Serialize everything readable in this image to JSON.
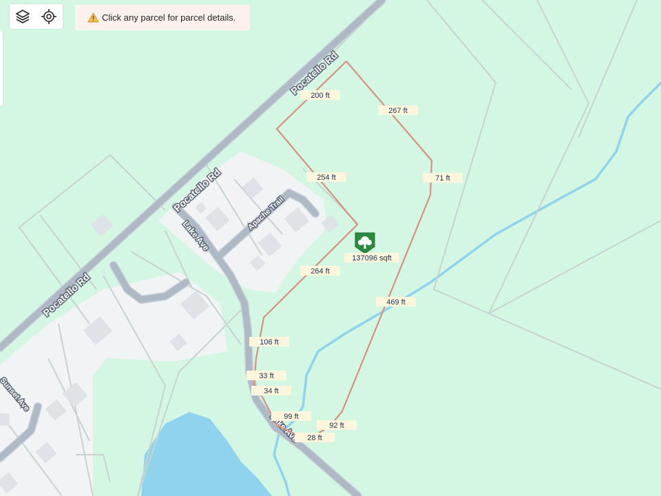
{
  "toolbar": {
    "layers_icon": "layers-icon",
    "locate_icon": "crosshair-locate-icon"
  },
  "notice": {
    "icon": "warning-triangle-icon",
    "text": "Click any parcel for parcel details."
  },
  "roads": {
    "pocatello_1": "Pocatello Rd",
    "pocatello_2": "Pocatello Rd",
    "pocatello_3": "Pocatello Rd",
    "lake_ave_1": "Lake Ave",
    "lake_ave_2": "Lake Ave",
    "apache_trail": "Apache Trail",
    "sunset_ave": "Sunset Ave"
  },
  "parcel": {
    "area": "137096 sqft",
    "icon": "tree-marker-icon",
    "dimensions": [
      "200 ft",
      "267 ft",
      "254 ft",
      "71 ft",
      "264 ft",
      "469 ft",
      "106 ft",
      "33 ft",
      "34 ft",
      "99 ft",
      "92 ft",
      "28 ft"
    ]
  },
  "colors": {
    "land": "#d3f7e2",
    "developed": "#f1f3f5",
    "road": "#aeb9c5",
    "road_edge": "#c5cdd6",
    "water": "#8fd3ee",
    "parcel_outline": "#d98f80",
    "parcel_lines": "#c8d2d0",
    "building": "#dfe2e7"
  }
}
